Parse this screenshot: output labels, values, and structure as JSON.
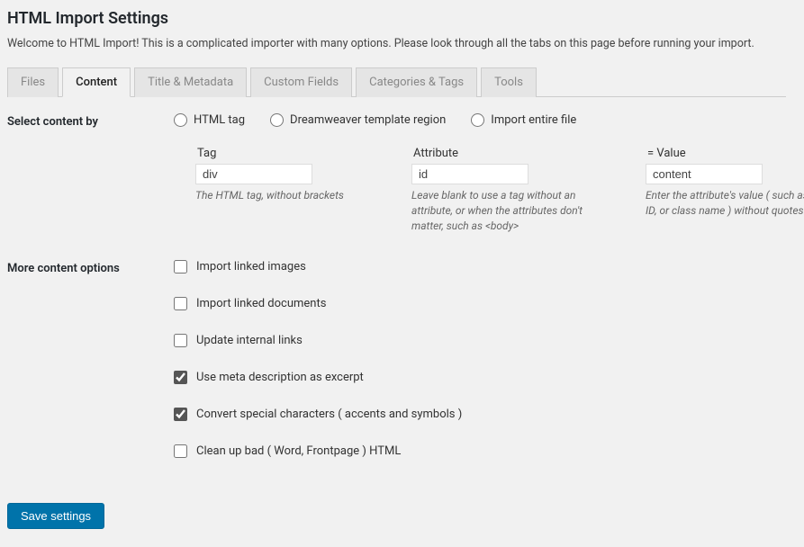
{
  "title": "HTML Import Settings",
  "intro": "Welcome to HTML Import! This is a complicated importer with many options. Please look through all the tabs on this page before running your import.",
  "tabs": {
    "files": "Files",
    "content": "Content",
    "title_metadata": "Title & Metadata",
    "custom_fields": "Custom Fields",
    "categories_tags": "Categories & Tags",
    "tools": "Tools"
  },
  "select_content": {
    "label": "Select content by",
    "radios": {
      "html_tag": "HTML tag",
      "dreamweaver": "Dreamweaver template region",
      "import_entire": "Import entire file"
    },
    "fields": {
      "tag": {
        "label": "Tag",
        "value": "div",
        "help": "The HTML tag, without brackets"
      },
      "attribute": {
        "label": "Attribute",
        "value": "id",
        "help": "Leave blank to use a tag without an attribute, or when the attributes don't matter, such as <body>"
      },
      "value": {
        "label": "= Value",
        "value": "content",
        "help": "Enter the attribute's value ( such as width, ID, or class name ) without quotes"
      }
    }
  },
  "more_options": {
    "label": "More content options",
    "items": {
      "import_images": "Import linked images",
      "import_documents": "Import linked documents",
      "update_links": "Update internal links",
      "meta_excerpt": "Use meta description as excerpt",
      "convert_chars": "Convert special characters ( accents and symbols )",
      "clean_html": "Clean up bad ( Word, Frontpage ) HTML"
    }
  },
  "save_button": "Save settings"
}
